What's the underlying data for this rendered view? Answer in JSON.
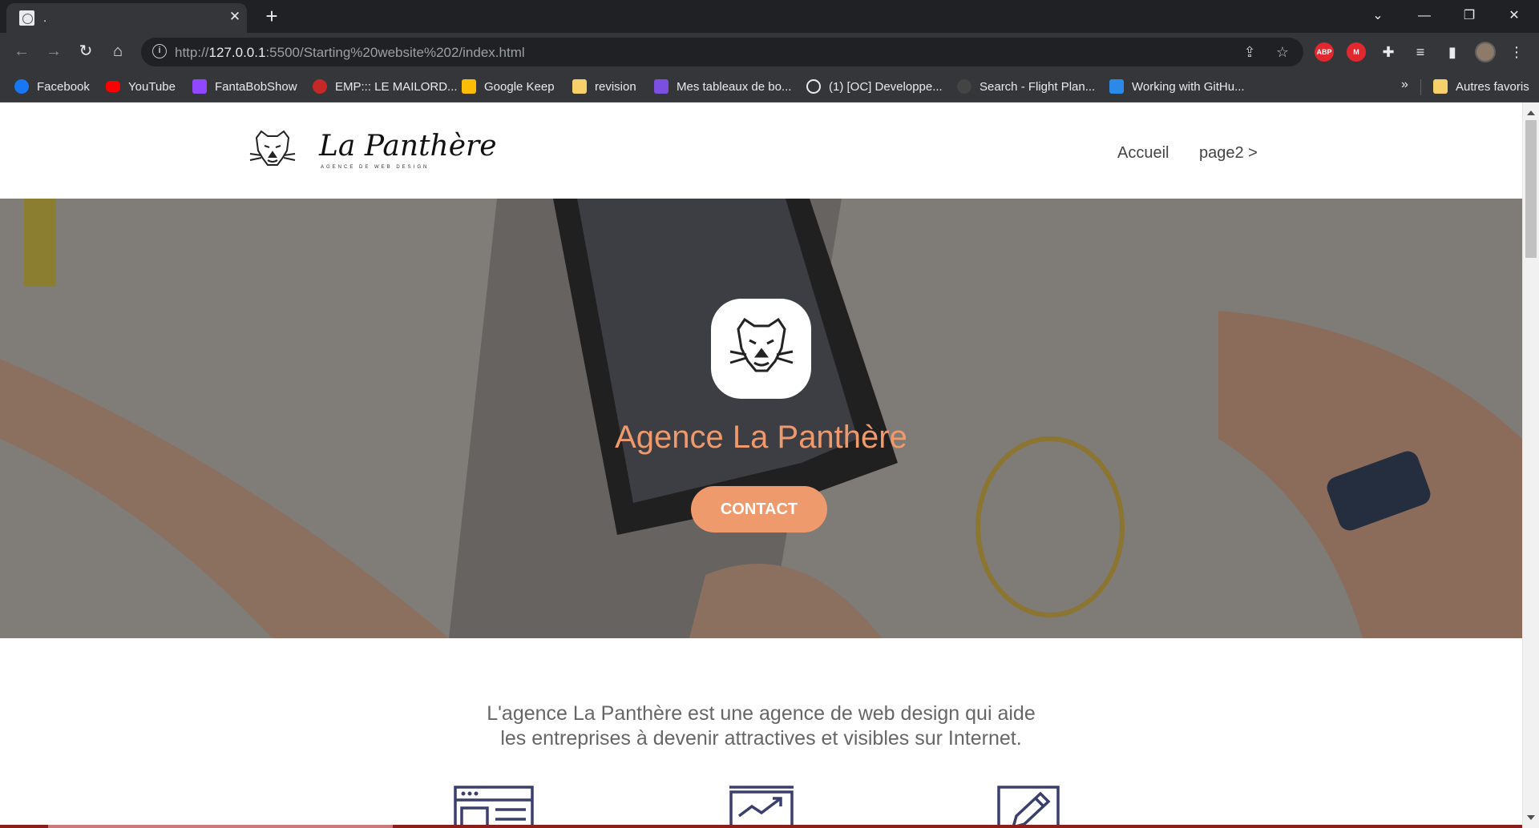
{
  "browser": {
    "tab_title": ".",
    "url_prefix": "http://",
    "url_host": "127.0.0.1",
    "url_rest": ":5500/Starting%20website%202/index.html",
    "extensions": [
      "ABP",
      "M"
    ],
    "bookmarks": [
      {
        "label": "Facebook",
        "icon": "facebook-icon",
        "color": "#1877f2"
      },
      {
        "label": "YouTube",
        "icon": "youtube-icon",
        "color": "#ff0000"
      },
      {
        "label": "FantaBobShow",
        "icon": "twitch-icon",
        "color": "#9146ff"
      },
      {
        "label": "EMP::: LE MAILORD...",
        "icon": "emp-icon",
        "color": "#c62828"
      },
      {
        "label": "Google Keep",
        "icon": "keep-icon",
        "color": "#fbbc04"
      },
      {
        "label": "revision",
        "icon": "folder-icon",
        "color": "#f6d16b"
      },
      {
        "label": "Mes tableaux de bo...",
        "icon": "board-icon",
        "color": "#7b4fe0"
      },
      {
        "label": "(1) [OC] Developpe...",
        "icon": "openclassrooms-icon",
        "color": "#e8eaed"
      },
      {
        "label": "Search - Flight Plan...",
        "icon": "flightplan-icon",
        "color": "#444444"
      },
      {
        "label": "Working with GitHu...",
        "icon": "vscode-icon",
        "color": "#2b8ae8"
      }
    ],
    "bookmarks_more": "»",
    "other_bookmarks": "Autres favoris"
  },
  "site": {
    "logo_text": "La Panthère",
    "logo_subtitle": "AGENCE DE WEB DESIGN",
    "nav": [
      "Accueil",
      "page2 >"
    ],
    "hero_title": "Agence La Panthère",
    "cta_label": "CONTACT",
    "intro_line1": "L'agence La Panthère est une agence de web design qui aide",
    "intro_line2": "les entreprises à devenir attractives et visibles sur Internet."
  },
  "colors": {
    "accent": "#ef9a6d",
    "chrome_dark": "#202124",
    "chrome_toolbar": "#35363a",
    "feature_icon": "#3a3f6e"
  }
}
